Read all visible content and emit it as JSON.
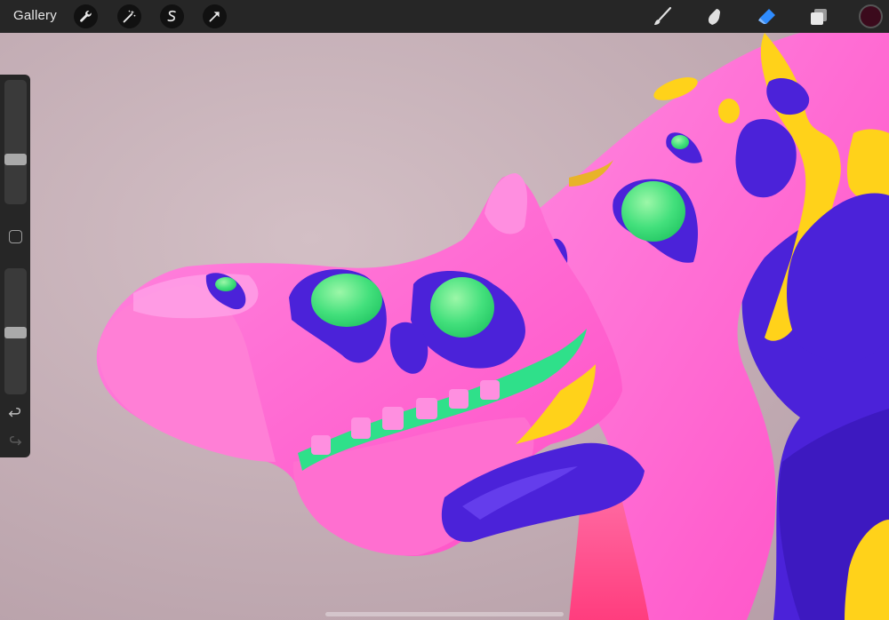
{
  "topbar": {
    "gallery_label": "Gallery",
    "left_tools": [
      "wrench-icon",
      "magic-wand-icon",
      "selection-s-icon",
      "transform-arrow-icon"
    ],
    "right_tools": [
      "brush-icon",
      "smudge-icon",
      "eraser-icon",
      "layers-icon"
    ],
    "active_tool": "eraser-icon",
    "current_color": "#3b0a1c"
  },
  "sidebar": {
    "brush_size_level": 0.62,
    "opacity_level": 0.52,
    "controls": [
      "brush-size-slider",
      "modify-button",
      "opacity-slider",
      "undo-icon",
      "redo-icon"
    ]
  },
  "canvas": {
    "background_color": "#c9b3ba",
    "artwork_colors": {
      "body_pink": "#ff5fd0",
      "highlight_pink": "#ff9ae6",
      "purple": "#4a1fd8",
      "green": "#3fe47a",
      "yellow": "#ffd21a",
      "teeth_green": "#2fe08a"
    }
  }
}
